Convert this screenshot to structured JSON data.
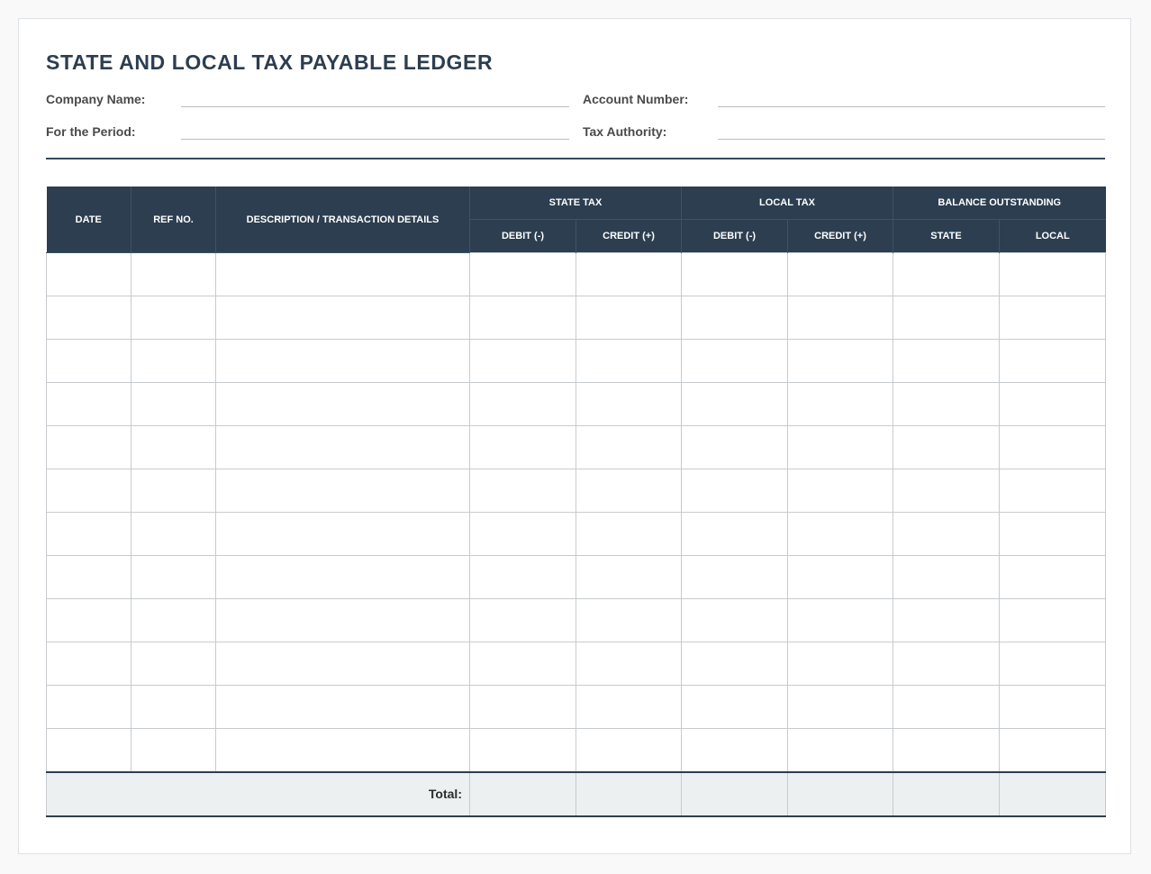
{
  "title": "STATE AND LOCAL TAX PAYABLE LEDGER",
  "fields": {
    "company_name": "Company Name:",
    "account_number": "Account Number:",
    "period": "For the Period:",
    "tax_authority": "Tax Authority:"
  },
  "table": {
    "headers": {
      "date": "DATE",
      "ref_no": "REF NO.",
      "description": "DESCRIPTION / TRANSACTION DETAILS",
      "state_tax": "STATE TAX",
      "local_tax": "LOCAL TAX",
      "balance_outstanding": "BALANCE OUTSTANDING",
      "state_debit": "DEBIT (-)",
      "state_credit": "CREDIT (+)",
      "local_debit": "DEBIT (-)",
      "local_credit": "CREDIT (+)",
      "balance_state": "STATE",
      "balance_local": "LOCAL"
    },
    "total_label": "Total:"
  },
  "colors": {
    "header_bg": "#2c3e50",
    "total_bg": "#ecf0f1",
    "title": "#2c3e50"
  }
}
